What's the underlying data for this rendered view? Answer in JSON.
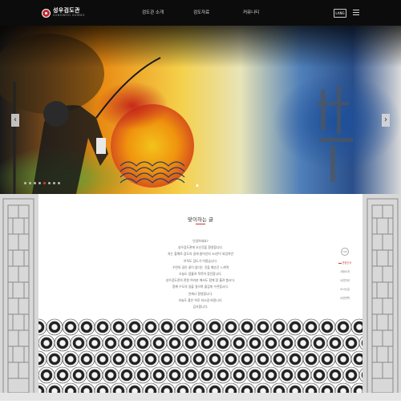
{
  "brand": {
    "name": "성우검도관",
    "subtitle": "SUNGWOO KUMDO",
    "mark_color": "#c0272d"
  },
  "nav": {
    "items": [
      {
        "label": "검도관 소개"
      },
      {
        "label": "검도자료"
      },
      {
        "label": "커뮤니티"
      }
    ],
    "lang_label": "LANG",
    "menu_icon": "hamburger-icon"
  },
  "hero": {
    "prev_icon": "chevron-left-icon",
    "next_icon": "chevron-right-icon",
    "slide_count": 8,
    "active_slide": 4,
    "scroll_icon": "triangle-up-icon"
  },
  "section": {
    "title": "맞이하는 글",
    "accent_color": "#cc3333",
    "lines": [
      "안녕하세요?",
      "성우검도관에 오신것을 환영합니다.",
      "저는 올해로 검도의 길에 들어선지 30년이 되었지만",
      "아직도 검도가 어렵습니다.",
      "수련의 길은 끝이 없다는 것을 매순간 느끼며",
      "오늘도 땀흘려 묵묵히 정진합니다.",
      "성우검도관의 관원 여러분 께서도 함께 땀 흘려 봅시다.",
      "함께 수도의 길을 걸으며 즐겁게 수련합시다.",
      "언제나 환영합니다.",
      "오늘도 좋은 하루 되시길 바랍니다.",
      "감사합니다."
    ]
  },
  "subnav": {
    "top_label": "TOP",
    "items": [
      {
        "label": "관장인사",
        "active": true
      },
      {
        "label": "사범소개",
        "active": false
      },
      {
        "label": "수련안내",
        "active": false
      },
      {
        "label": "오시는길",
        "active": false
      },
      {
        "label": "수련연혁",
        "active": false
      }
    ]
  }
}
